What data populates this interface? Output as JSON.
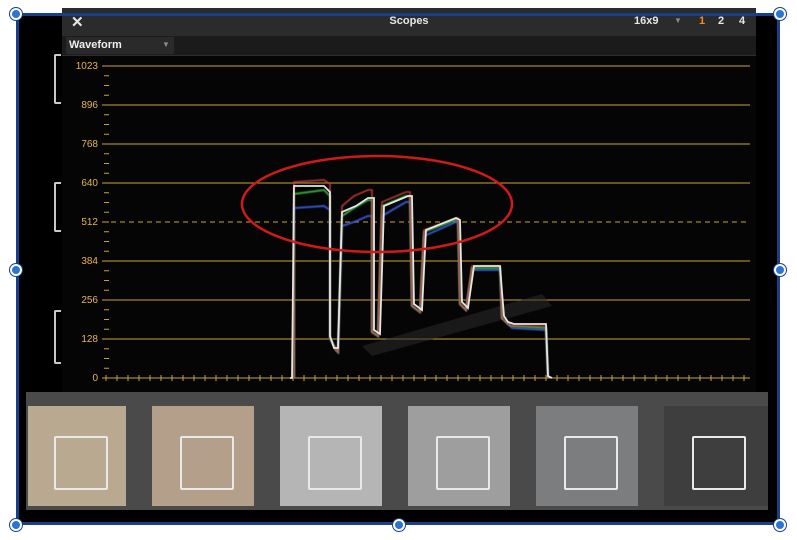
{
  "scopes_window": {
    "title": "Scopes",
    "close_icon": "close-icon",
    "aspect_ratio": "16x9",
    "layout_options": [
      "1",
      "2",
      "4"
    ],
    "active_layout": "1",
    "scope_type": "Waveform",
    "dropdown_icon": "chevron-down-icon"
  },
  "waveform": {
    "y_ticks": [
      "1023",
      "896",
      "768",
      "640",
      "512",
      "384",
      "256",
      "128",
      "0"
    ],
    "dashed_reference": "512",
    "colors": {
      "graticule": "#c9a23a",
      "tick_labels": "#e8b54a",
      "luma_trace": "#e6e6e6",
      "highlight_ellipse": "#d01a1a",
      "red_channel": "#d94040",
      "green_channel": "#35b545",
      "blue_channel": "#3a5be0"
    }
  },
  "chip_chart": {
    "colors": [
      "#b8a990",
      "#b39f8a",
      "#b5b5b5",
      "#9e9e9e",
      "#7c7d7f",
      "#3e3e3e"
    ]
  },
  "selection_frame": {
    "accent": "#2a74d6"
  }
}
